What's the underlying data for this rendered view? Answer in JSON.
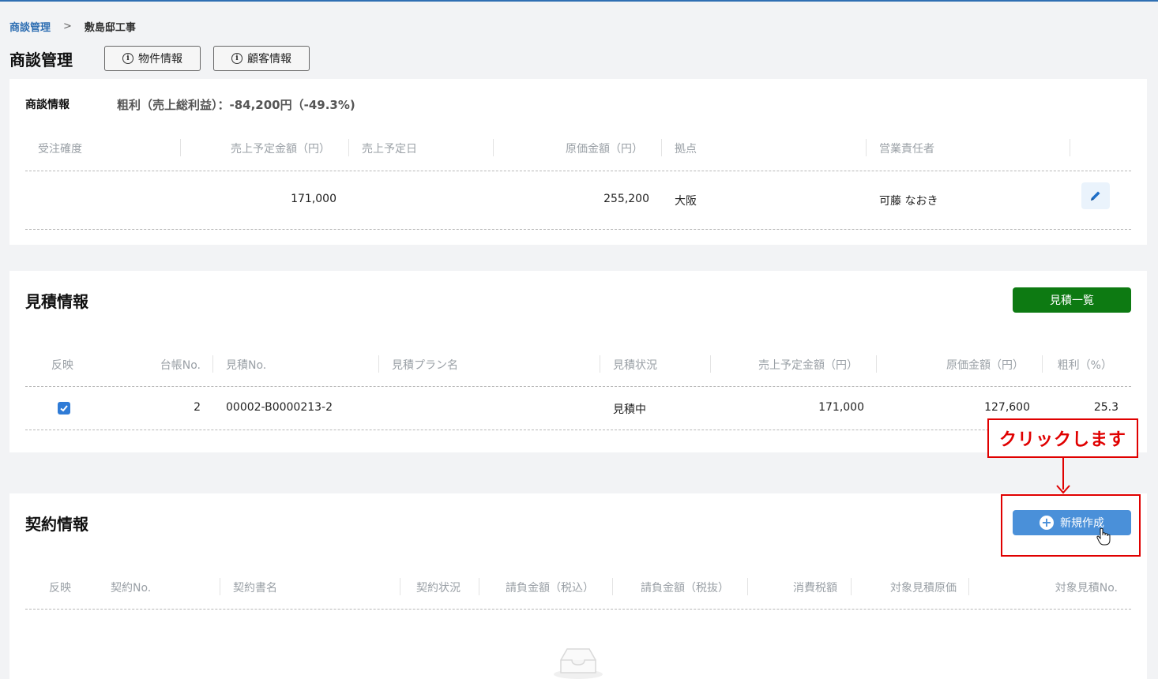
{
  "breadcrumb": {
    "link": "商談管理",
    "separator": ">",
    "current": "敷島邸工事"
  },
  "header": {
    "title": "商談管理",
    "property_info_label": "物件情報",
    "customer_info_label": "顧客情報"
  },
  "deal": {
    "section_label": "商談情報",
    "gross_profit_text": "粗利（売上総利益）：-84,200円（-49.3%)",
    "columns": [
      "受注確度",
      "売上予定金額（円）",
      "売上予定日",
      "原価金額（円）",
      "拠点",
      "営業責任者"
    ],
    "row": {
      "order_probability": "",
      "planned_sales": "171,000",
      "planned_date": "",
      "cost": "255,200",
      "base": "大阪",
      "sales_manager": "可藤 なおき"
    }
  },
  "estimate": {
    "title": "見積情報",
    "list_button": "見積一覧",
    "columns": [
      "反映",
      "台帳No.",
      "見積No.",
      "見積プラン名",
      "見積状況",
      "売上予定金額（円）",
      "原価金額（円）",
      "粗利（%）"
    ],
    "rows": [
      {
        "reflect": true,
        "ledger_no": "2",
        "estimate_no": "00002-B0000213-2",
        "plan_name": "",
        "status": "見積中",
        "planned_sales": "171,000",
        "cost": "127,600",
        "gross_margin": "25.3"
      }
    ]
  },
  "contract": {
    "title": "契約情報",
    "new_button": "新規作成",
    "columns": [
      "反映",
      "契約No.",
      "契約書名",
      "契約状況",
      "請負金額（税込）",
      "請負金額（税抜）",
      "消費税額",
      "対象見積原価",
      "対象見積No."
    ],
    "rows": []
  },
  "annotation": {
    "callout_text": "クリックします",
    "accent_color": "#e00000"
  },
  "colors": {
    "primary_blue": "#4a90d9",
    "green": "#0d7a12",
    "link_blue": "#2f6fb3"
  }
}
